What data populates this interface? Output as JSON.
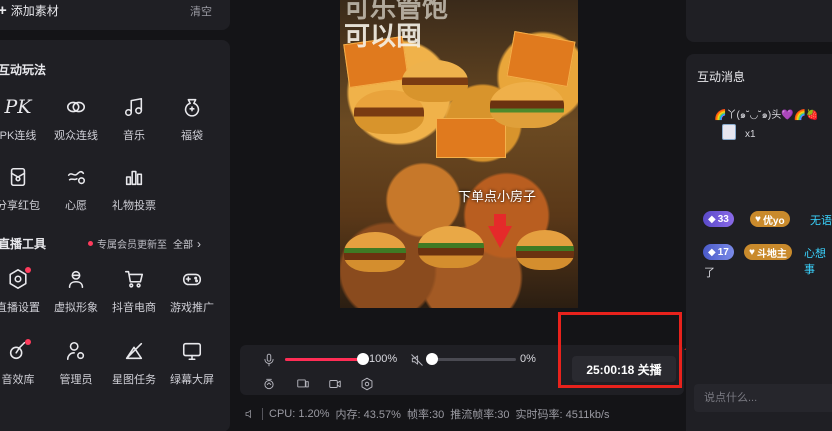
{
  "left_top": {
    "add_label": "添加素材",
    "clear_label": "清空"
  },
  "interactive": {
    "title": "互动玩法",
    "items": [
      {
        "label": "PK连线",
        "icon": "pk-icon"
      },
      {
        "label": "观众连线",
        "icon": "link-icon"
      },
      {
        "label": "音乐",
        "icon": "music-icon"
      },
      {
        "label": "福袋",
        "icon": "lucky-bag-icon"
      },
      {
        "label": "分享红包",
        "icon": "red-packet-icon"
      },
      {
        "label": "心愿",
        "icon": "wish-icon"
      },
      {
        "label": "礼物投票",
        "icon": "vote-icon"
      }
    ]
  },
  "live_tools": {
    "title": "直播工具",
    "vip_note": "专属会员更新至",
    "all_label": "全部",
    "items": [
      {
        "label": "直播设置",
        "icon": "settings-icon",
        "dot": true
      },
      {
        "label": "虚拟形象",
        "icon": "avatar-icon",
        "dot": false
      },
      {
        "label": "抖音电商",
        "icon": "cart-icon",
        "dot": false
      },
      {
        "label": "游戏推广",
        "icon": "gamepad-icon",
        "dot": false
      },
      {
        "label": "音效库",
        "icon": "sound-effect-icon",
        "dot": true
      },
      {
        "label": "管理员",
        "icon": "admin-icon",
        "dot": false
      },
      {
        "label": "星图任务",
        "icon": "star-map-icon",
        "dot": false
      },
      {
        "label": "绿幕大屏",
        "icon": "green-screen-icon",
        "dot": false
      }
    ]
  },
  "preview": {
    "caption_top_line1": "可乐管饱",
    "caption_top_line2": "可以囤",
    "caption_mid": "下单点小房子"
  },
  "controls": {
    "mic_volume": 100,
    "mic_volume_label": "100%",
    "speaker_volume": 0,
    "speaker_volume_label": "0%",
    "timer_label": "25:00:18 关播"
  },
  "status": {
    "cpu": "CPU: 1.20%",
    "memory": "内存: 43.57%",
    "fps": "帧率:30",
    "stream_fps": "推流帧率:30",
    "bitrate": "实时码率: 4511kb/s"
  },
  "messages": {
    "title": "互动消息",
    "gift_line": "🌈丫(๑˘◡˘๑)头💜🌈🍓",
    "gift_count": "x1",
    "rows": [
      {
        "level": "33",
        "fan_badge": "优yo",
        "text": "无语"
      },
      {
        "level": "17",
        "fan_badge": "斗地主",
        "text": "心想事"
      }
    ],
    "wrap_text": "了",
    "input_placeholder": "说点什么..."
  },
  "colors": {
    "accent_red": "#ff2d55",
    "highlight": "#e8221c",
    "link_cyan": "#3ad4ff"
  }
}
